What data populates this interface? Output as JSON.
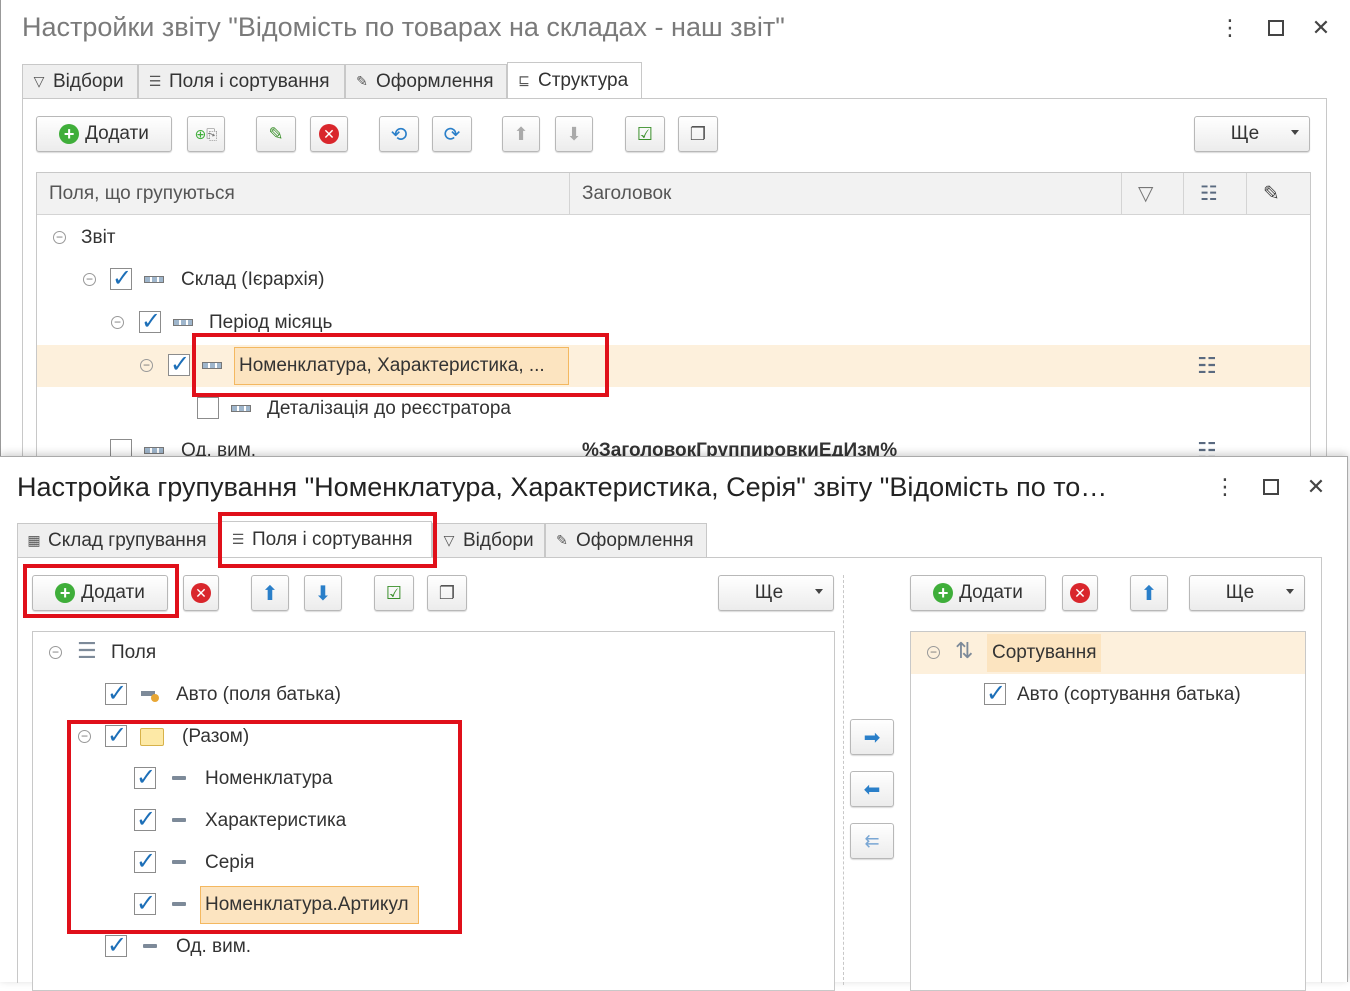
{
  "win1": {
    "title": "Настройки звіту \"Відомість по товарах на складах - наш звіт\"",
    "tabs": [
      "Відбори",
      "Поля і сортування",
      "Оформлення",
      "Структура"
    ],
    "toolbar": {
      "add_label": "Додати",
      "more_label": "Ще"
    },
    "columns": {
      "grouped": "Поля, що групуються",
      "heading": "Заголовок"
    },
    "tree": {
      "root": "Звіт",
      "warehouse": "Склад (Ієрархія)",
      "period": "Період місяць",
      "nomenclature": "Номенклатура, Характеристика, ...",
      "detail": "Деталізація до реєстратора",
      "unit": "Од. вим.",
      "unit_heading": "%ЗаголовокГруппировкиЕдИзм%"
    }
  },
  "win2": {
    "title": "Настройка групування \"Номенклатура, Характеристика, Серія\" звіту \"Відомість по то…",
    "tabs": [
      "Склад групування",
      "Поля і сортування",
      "Відбори",
      "Оформлення"
    ],
    "toolbar": {
      "add_label": "Додати",
      "more_label": "Ще"
    },
    "fields": {
      "root": "Поля",
      "auto": "Авто (поля батька)",
      "together": "(Разом)",
      "items": [
        "Номенклатура",
        "Характеристика",
        "Серія",
        "Номенклатура.Артикул"
      ],
      "unit": "Од. вим."
    },
    "sorting": {
      "add_label": "Додати",
      "more_label": "Ще",
      "root": "Сортування",
      "auto": "Авто (сортування батька)"
    }
  },
  "colors": {
    "highlight": "#fce4c0",
    "accent_red": "#e0101a",
    "check_blue": "#1d6fb8"
  }
}
